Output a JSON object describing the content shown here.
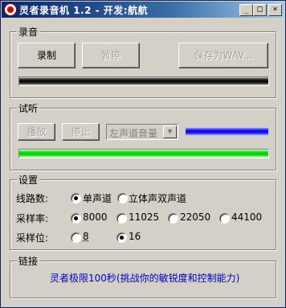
{
  "window": {
    "title": "灵者录音机 1.2 - 开发:航航",
    "buttons": {
      "minimize": "_",
      "maximize": "□",
      "close": "×"
    }
  },
  "record": {
    "group_label": "录音",
    "record_button": "录制",
    "pause_button": "暂停",
    "save_button": "保存为WAV..."
  },
  "listen": {
    "group_label": "试听",
    "play_button": "播放",
    "stop_button": "停止",
    "channel_select": "左声道音量"
  },
  "settings": {
    "group_label": "设置",
    "channels_label": "线路数:",
    "channel_options": [
      "单声道",
      "立体声双声道"
    ],
    "channel_selected": "单声道",
    "rate_label": "采样率:",
    "rate_options": [
      "8000",
      "11025",
      "22050",
      "44100"
    ],
    "rate_selected": "8000",
    "bits_label": "采样位:",
    "bits_options": [
      "8",
      "16"
    ],
    "bits_selected": "16"
  },
  "links": {
    "group_label": "链接",
    "link_text": "灵者极限100秒(挑战你的敏锐度和控制能力)"
  }
}
